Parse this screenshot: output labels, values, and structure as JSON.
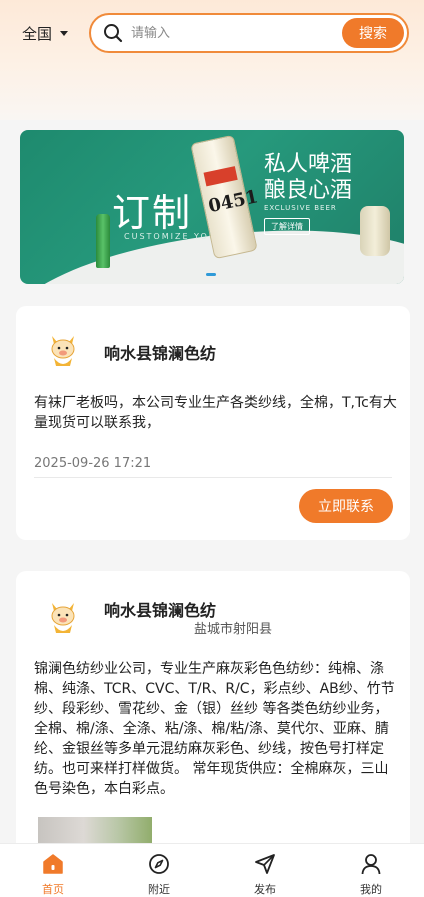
{
  "header": {
    "region_label": "全国",
    "search_placeholder": "请输入",
    "search_button": "搜索"
  },
  "banner": {
    "main_text": "订制",
    "title": "私人啤酒 酿良心酒",
    "subtitle": "CUSTOMIZE YOUR",
    "eng_text": "EXCLUSIVE BEER",
    "button_label": "了解详情",
    "can_text": "0451"
  },
  "posts": [
    {
      "company": "响水县锦澜色纺",
      "location": "",
      "text": "有袜厂老板吗，本公司专业生产各类纱线，全棉，T,Tc有大量现货可以联系我，",
      "time": "2025-09-26 17:21",
      "action_label": "立即联系"
    },
    {
      "company": "响水县锦澜色纺",
      "location": "盐城市射阳县",
      "text": "锦澜色纺纱业公司，专业生产麻灰彩色色纺纱：纯棉、涤棉、纯涤、TCR、CVC、T/R、R/C，彩点纱、AB纱、竹节纱、段彩纱、雪花纱、金（银）丝纱 等各类色纺纱业务，全棉、棉/涤、全涤、粘/涤、棉/粘/涤、莫代尔、亚麻、腈纶、金银丝等多单元混纺麻灰彩色、纱线，按色号打样定纺。也可来样打样做货。 常年现货供应：全棉麻灰，三山色号染色，本白彩点。"
    }
  ],
  "nav": [
    {
      "label": "首页",
      "icon": "home-icon",
      "active": true
    },
    {
      "label": "附近",
      "icon": "compass-icon",
      "active": false
    },
    {
      "label": "发布",
      "icon": "send-icon",
      "active": false
    },
    {
      "label": "我的",
      "icon": "user-icon",
      "active": false
    }
  ],
  "colors": {
    "accent": "#f07a2a",
    "banner_green": "#1e8a6e"
  }
}
